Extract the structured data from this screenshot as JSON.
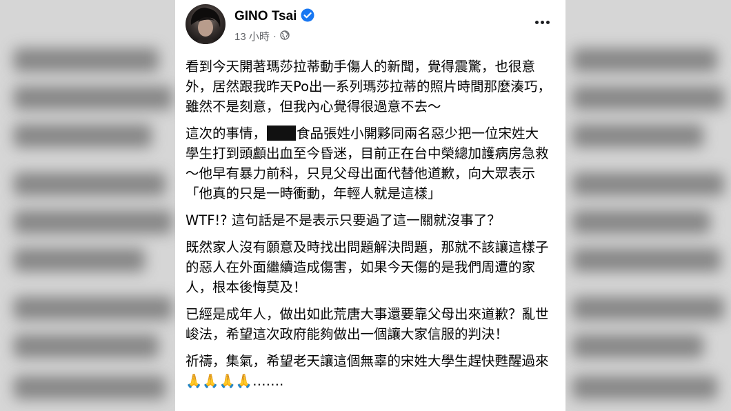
{
  "post": {
    "author_name": "GINO Tsai",
    "timestamp": "13 小時",
    "separator": "·",
    "audience_icon": "globe-icon",
    "verified_icon": "verified-badge-icon",
    "more_icon": "more-options-icon",
    "paragraphs": [
      "看到今天開著瑪莎拉蒂動手傷人的新聞，覺得震驚，也很意外，居然跟我昨天Po出一系列瑪莎拉蒂的照片時間那麼湊巧，雖然不是刻意，但我內心覺得很過意不去～",
      "這次的事情，",
      "食品張姓小開夥同兩名惡少把一位宋姓大學生打到頭顱出血至今昏迷，目前正在台中榮總加護病房急救～他早有暴力前科，只見父母出面代替他道歉，向大眾表示「他真的只是一時衝動，年輕人就是這樣」",
      "WTF!? 這句話是不是表示只要過了這一關就沒事了？",
      "既然家人沒有願意及時找出問題解決問題，那就不該讓這樣子的惡人在外面繼續造成傷害，如果今天傷的是我們周遭的家人，根本後悔莫及！",
      "已經是成年人，做出如此荒唐大事還要靠父母出來道歉？亂世峻法，希望這次政府能夠做出一個讓大家信服的判決！",
      "祈禱，集氣，希望老天讓這個無辜的宋姓大學生趕快甦醒過來",
      "🙏🙏🙏🙏",
      "……."
    ]
  },
  "colors": {
    "text": "#050505",
    "secondary_text": "#65676b",
    "verified_blue": "#1877f2",
    "redaction": "#111111"
  }
}
